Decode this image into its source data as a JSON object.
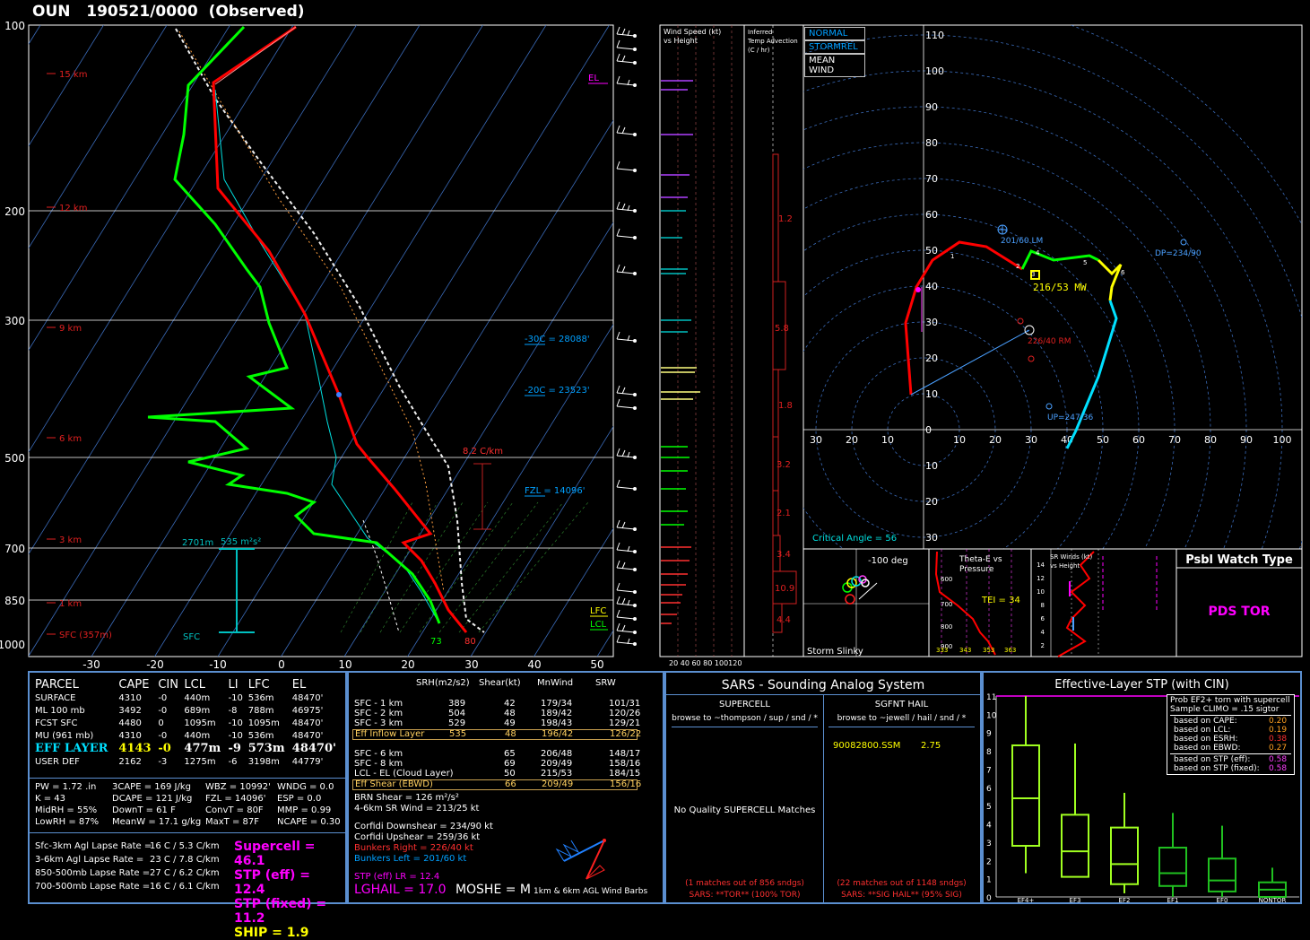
{
  "header": {
    "title": "OUN   190521/0000  (Observed)"
  },
  "skewt": {
    "pressure_labels": [
      "100",
      "200",
      "300",
      "500",
      "700",
      "850",
      "1000"
    ],
    "height_labels": [
      "15 km",
      "12 km",
      "9 km",
      "6 km",
      "3 km",
      "1 km",
      "SFC (357m)"
    ],
    "temp_ticks": [
      "-30",
      "-20",
      "-10",
      "0",
      "10",
      "20",
      "30",
      "40",
      "50"
    ],
    "annotations": {
      "el": "EL",
      "lfc": "LFC",
      "lcl": "LCL",
      "m30c": "-30C = 28088'",
      "m20c": "-20C = 23523'",
      "fzl": "FZL = 14096'",
      "lapse": "8.2 C/km",
      "eff_layer": "2701m",
      "esrh": "535 m²s²",
      "sfc": "SFC",
      "sfc_td": "73",
      "sfc_t": "80"
    }
  },
  "side": {
    "wind_title1": "Wind Speed (kt)",
    "wind_title2": "vs Height",
    "wind_ticks": "20  40  60  80  100120",
    "adv_title1": "Inferred",
    "adv_title2": "Temp Advection",
    "adv_title3": "(C / hr)",
    "adv_values": [
      "1.2",
      "5.8",
      "1.8",
      "3.2",
      "2.1",
      "3.4",
      "10.9",
      "4.4"
    ]
  },
  "hodograph": {
    "buttons": [
      "NORMAL",
      "STORMREL",
      "MEAN WIND"
    ],
    "rings_y": [
      "110",
      "100",
      "90",
      "80",
      "70",
      "60",
      "50",
      "40",
      "30",
      "20",
      "10",
      "0"
    ],
    "rings_x": [
      "30",
      "20",
      "10",
      "10",
      "20",
      "30",
      "40",
      "50",
      "60",
      "70",
      "80",
      "90",
      "100"
    ],
    "rings_neg": [
      "10",
      "20",
      "30"
    ],
    "lm": "201/60 LM",
    "rm": "226/40 RM",
    "mw": "216/53 MW",
    "dp": "DP=234/90",
    "up": "UP=247/36",
    "critical": "Critical Angle = 56",
    "height_marks": [
      "1",
      "2",
      "3",
      "4",
      "5",
      "6"
    ]
  },
  "insets": {
    "slinky": "Storm Slinky",
    "slinky_deg": "-100 deg",
    "thetae_title1": "Theta-E vs",
    "thetae_title2": "Pressure",
    "tei": "TEI = 34",
    "thetae_p": [
      "600",
      "700",
      "800",
      "900"
    ],
    "thetae_x": [
      "333",
      "343",
      "353",
      "363"
    ],
    "srw_title1": "SR Winds (kt)",
    "srw_title2": "vs Height",
    "srw_ticks": [
      "14",
      "12",
      "10",
      "8",
      "6",
      "4",
      "2"
    ],
    "watch_title": "Psbl Watch Type",
    "watch_value": "PDS TOR"
  },
  "parcels": {
    "headers": [
      "PARCEL",
      "CAPE",
      "CIN",
      "LCL",
      "LI",
      "LFC",
      "EL"
    ],
    "rows": [
      [
        "SURFACE",
        "4310",
        "-0",
        "440m",
        "-10",
        "536m",
        "48470'"
      ],
      [
        "ML 100 mb",
        "3492",
        "-0",
        "689m",
        "-8",
        "788m",
        "46975'"
      ],
      [
        "FCST SFC",
        "4480",
        "0",
        "1095m",
        "-10",
        "1095m",
        "48470'"
      ],
      [
        "MU   (961 mb)",
        "4310",
        "-0",
        "440m",
        "-10",
        "536m",
        "48470'"
      ],
      [
        "EFF  LAYER",
        "4143",
        "-0",
        "477m",
        "-9",
        "573m",
        "48470'"
      ],
      [
        "USER DEF",
        "2162",
        "-3",
        "1275m",
        "-6",
        "3198m",
        "44779'"
      ]
    ],
    "thermo": [
      [
        "PW = 1.72 .in",
        "3CAPE = 169 J/kg",
        "WBZ = 10992'",
        "WNDG = 0.0"
      ],
      [
        "K = 43",
        "DCAPE = 121 J/kg",
        "FZL = 14096'",
        "ESP = 0.0"
      ],
      [
        "MidRH = 55%",
        "DownT = 61 F",
        "ConvT = 80F",
        "MMP = 0.99"
      ],
      [
        "LowRH = 87%",
        "MeanW = 17.1 g/kg",
        "MaxT = 87F",
        "NCAPE = 0.30"
      ]
    ],
    "lapse": [
      [
        "Sfc-3km Agl Lapse Rate =",
        "16 C / 5.3 C/km"
      ],
      [
        "3-6km Agl Lapse Rate =",
        "23 C / 7.8 C/km"
      ],
      [
        "850-500mb Lapse Rate =",
        "27 C / 6.2 C/km"
      ],
      [
        "700-500mb Lapse Rate =",
        "16 C / 6.1 C/km"
      ]
    ],
    "indices": {
      "supercell": "Supercell = 46.1",
      "stp_eff": "STP (eff) = 12.4",
      "stp_fixed": "STP (fixed) = 11.2",
      "ship": "SHIP = 1.9"
    }
  },
  "kinematics": {
    "headers": [
      "SRH(m2/s2)",
      "Shear(kt)",
      "MnWind",
      "SRW"
    ],
    "rows": [
      [
        "SFC - 1 km",
        "389",
        "42",
        "179/34",
        "101/31"
      ],
      [
        "SFC - 2 km",
        "504",
        "48",
        "189/42",
        "120/26"
      ],
      [
        "SFC - 3 km",
        "529",
        "49",
        "198/43",
        "129/21"
      ],
      [
        "Eff Inflow Layer",
        "535",
        "48",
        "196/42",
        "126/22"
      ],
      [
        "",
        "",
        " ",
        "",
        ""
      ],
      [
        "SFC - 6 km",
        "",
        "65",
        "206/48",
        "148/17"
      ],
      [
        "SFC - 8 km",
        "",
        "69",
        "209/49",
        "158/16"
      ],
      [
        "LCL - EL (Cloud Layer)",
        "",
        "50",
        "215/53",
        "184/15"
      ],
      [
        "Eff Shear (EBWD)",
        "",
        "66",
        "209/49",
        "156/16"
      ]
    ],
    "brn": "BRN Shear =  126 m²/s²",
    "sr46": "4-6km SR Wind =         213/25 kt",
    "corfidi_down": "Corfidi Downshear =      234/90 kt",
    "corfidi_up": "Corfidi Upshear =          259/36 kt",
    "bunkers_right": "Bunkers Right =            226/40 kt",
    "bunkers_left": "Bunkers Left =              201/60 kt",
    "stp_lr": "STP (eff) LR = 12.4",
    "lghail": "LGHAIL = 17.0",
    "moshe": "MOSHE = M",
    "barbs": "1km & 6km AGL Wind Barbs"
  },
  "sars": {
    "title": "SARS - Sounding Analog System",
    "supercell": "SUPERCELL",
    "hail": "SGFNT HAIL",
    "sup_browse": "browse to ~thompson / sup / snd / *",
    "hail_browse": "browse to ~jewell / hail / snd / *",
    "hail_match": "90082800.SSM",
    "hail_size": "2.75",
    "no_match": "No Quality SUPERCELL Matches",
    "sup_count": "(1 matches out of 856 sndgs)",
    "sup_result": "SARS:  **TOR**  (100% TOR)",
    "hail_count": "(22 matches out of 1148 sndgs)",
    "hail_result": "SARS:  **SIG HAIL**  (95% SIG)"
  },
  "stp": {
    "title": "Effective-Layer STP (with CIN)",
    "legend_title1": "Prob EF2+ torn with supercell",
    "legend_title2": "Sample CLIMO = .15 sigtor",
    "probs": [
      [
        "based on CAPE:",
        "0.20"
      ],
      [
        "based on LCL:",
        "0.19"
      ],
      [
        "based on ESRH:",
        "0.38"
      ],
      [
        "based on EBWD:",
        "0.27"
      ],
      [
        "based on STP (eff):",
        "0.58"
      ],
      [
        "based on STP (fixed):",
        "0.58"
      ]
    ],
    "y_ticks": [
      "11",
      "10",
      "9",
      "8",
      "7",
      "6",
      "5",
      "4",
      "3",
      "2",
      "1",
      "0"
    ],
    "categories": [
      "EF4+",
      "EF3",
      "EF2",
      "EF1",
      "EF0",
      "NONTOR"
    ]
  },
  "chart_data": {
    "type": "box",
    "title": "Effective-Layer STP (with CIN)",
    "categories": [
      "EF4+",
      "EF3",
      "EF2",
      "EF1",
      "EF0",
      "NONTOR"
    ],
    "ylim": [
      0,
      11
    ],
    "boxes": [
      {
        "low": 1.3,
        "q1": 2.8,
        "median": 5.4,
        "q3": 8.3,
        "high": 11.0
      },
      {
        "low": 1.1,
        "q1": 1.1,
        "median": 2.5,
        "q3": 4.5,
        "high": 8.4
      },
      {
        "low": 0.2,
        "q1": 0.7,
        "median": 1.8,
        "q3": 3.8,
        "high": 5.7
      },
      {
        "low": 0.0,
        "q1": 0.6,
        "median": 1.3,
        "q3": 2.7,
        "high": 4.6
      },
      {
        "low": 0.0,
        "q1": 0.3,
        "median": 0.9,
        "q3": 2.1,
        "high": 3.9
      },
      {
        "low": 0.0,
        "q1": 0.0,
        "median": 0.4,
        "q3": 0.8,
        "high": 1.6
      }
    ],
    "current": 12.4
  },
  "colors": {
    "temp": "#ff0000",
    "dew": "#00ff00",
    "parcel": "#ffffff",
    "wetbulb": "#00ffff",
    "isotherm": "#4a7ec8",
    "text_cyan": "#00c0ff",
    "text_magenta": "#ff00ff",
    "text_yellow": "#ffff00",
    "box_bright": "#a0ff20",
    "box_dark": "#20c020"
  }
}
